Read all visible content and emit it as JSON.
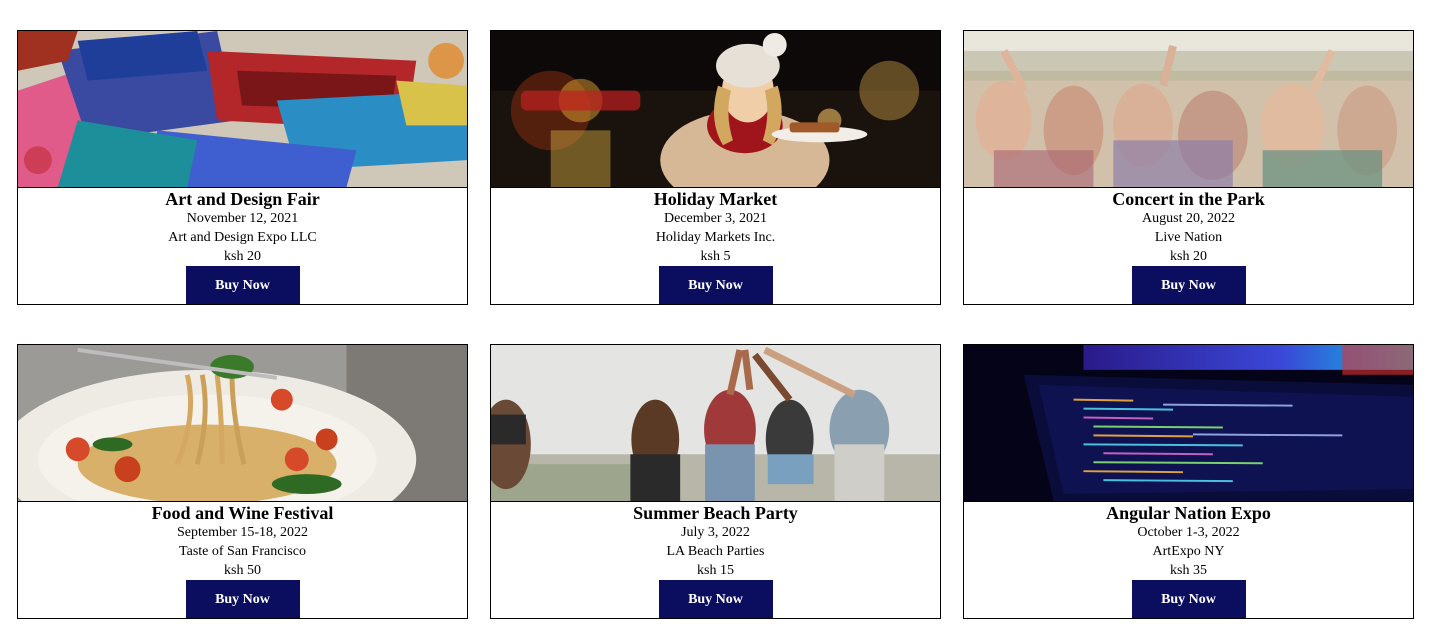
{
  "colors": {
    "button_bg": "#0b0e5e",
    "button_text": "#ffffff",
    "card_border": "#000000"
  },
  "events": [
    {
      "title": "Art and Design Fair",
      "date": "November 12, 2021",
      "organizer": "Art and Design Expo LLC",
      "price": "ksh 20",
      "button_label": "Buy Now",
      "image_subject": "paint-brushes-photo"
    },
    {
      "title": "Holiday Market",
      "date": "December 3, 2021",
      "organizer": "Holiday Markets Inc.",
      "price": "ksh 5",
      "button_label": "Buy Now",
      "image_subject": "woman-holiday-market-photo"
    },
    {
      "title": "Concert in the Park",
      "date": "August 20, 2022",
      "organizer": "Live Nation",
      "price": "ksh 20",
      "button_label": "Buy Now",
      "image_subject": "concert-crowd-photo"
    },
    {
      "title": "Food and Wine Festival",
      "date": "September 15-18, 2022",
      "organizer": "Taste of San Francisco",
      "price": "ksh 50",
      "button_label": "Buy Now",
      "image_subject": "spaghetti-plate-photo"
    },
    {
      "title": "Summer Beach Party",
      "date": "July 3, 2022",
      "organizer": "LA Beach Parties",
      "price": "ksh 15",
      "button_label": "Buy Now",
      "image_subject": "beach-party-friends-photo"
    },
    {
      "title": "Angular Nation Expo",
      "date": "October 1-3, 2022",
      "organizer": "ArtExpo NY",
      "price": "ksh 35",
      "button_label": "Buy Now",
      "image_subject": "laptop-code-screen-photo"
    }
  ]
}
